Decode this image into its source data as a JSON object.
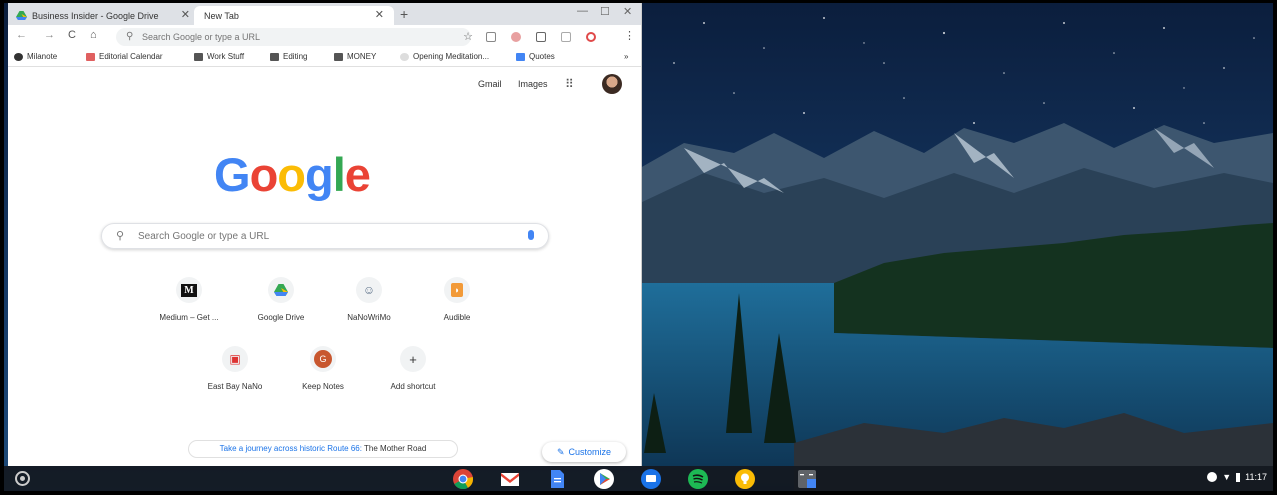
{
  "tabs": [
    {
      "title": "Business Insider - Google Drive",
      "active": false
    },
    {
      "title": "New Tab",
      "active": true
    }
  ],
  "window": {
    "new_tab_symbol": "+",
    "minimize": "—",
    "maximize": "☐",
    "close": "✕"
  },
  "toolbar": {
    "back": "←",
    "forward": "→",
    "reload": "C",
    "home": "⌂",
    "omnibox_placeholder": "Search Google or type a URL",
    "menu": "⋮"
  },
  "bookmarks": [
    "Milanote",
    "Editorial Calendar",
    "Work Stuff",
    "Editing",
    "MONEY",
    "Opening Meditation...",
    "Quotes"
  ],
  "bookmarks_overflow": "»",
  "ntp": {
    "gmail": "Gmail",
    "images": "Images",
    "logo_letters": [
      "G",
      "o",
      "o",
      "g",
      "l",
      "e"
    ],
    "search_placeholder": "Search Google or type a URL",
    "shortcuts": [
      {
        "label": "Medium – Get ...",
        "glyph": "M"
      },
      {
        "label": "Google Drive",
        "glyph": "▲"
      },
      {
        "label": "NaNoWriMo",
        "glyph": "☺"
      },
      {
        "label": "Audible",
        "glyph": "◗"
      },
      {
        "label": "East Bay NaNo",
        "glyph": "▣"
      },
      {
        "label": "Keep Notes",
        "glyph": "G"
      },
      {
        "label": "Add shortcut",
        "glyph": "+"
      }
    ],
    "promo_link": "Take a journey across historic Route 66:",
    "promo_rest": "The Mother Road",
    "customize": "Customize"
  },
  "shelf": {
    "apps": [
      "chrome-icon",
      "gmail-icon",
      "docs-icon",
      "play-store-icon",
      "messages-icon",
      "spotify-icon",
      "keep-icon",
      "calculator-icon"
    ],
    "time": "11:17"
  },
  "colors": {
    "google_blue": "#4285F4",
    "google_red": "#EA4335",
    "google_yellow": "#FBBC05",
    "google_green": "#34A853",
    "link": "#1A73E8"
  }
}
